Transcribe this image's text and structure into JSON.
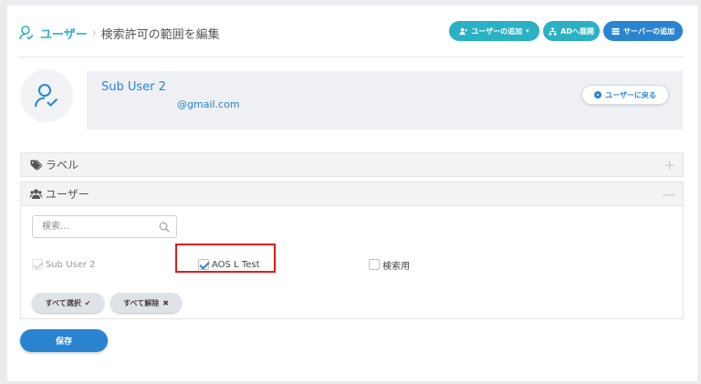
{
  "breadcrumb": {
    "root": "ユーザー",
    "separator": "›",
    "current": "検索許可の範囲を編集"
  },
  "header_buttons": {
    "add_user": "ユーザーの追加",
    "ad_deploy": "ADへ展開",
    "add_server": "サーバーの追加"
  },
  "profile": {
    "name": "Sub User 2",
    "email": "@gmail.com",
    "back_button": "ユーザーに戻る"
  },
  "sections": {
    "label": {
      "title": "ラベル",
      "toggle": "+"
    },
    "user": {
      "title": "ユーザー",
      "toggle": "—"
    }
  },
  "search": {
    "placeholder": "検索..."
  },
  "checkboxes": [
    {
      "label": "Sub User 2",
      "checked": true,
      "disabled": true
    },
    {
      "label": "AOS L Test",
      "checked": true,
      "disabled": false
    },
    {
      "label": "検索用",
      "checked": false,
      "disabled": false
    }
  ],
  "bulk": {
    "select_all": "すべて選択",
    "select_all_mark": "✔",
    "deselect_all": "すべて解除",
    "deselect_all_mark": "✖"
  },
  "save_label": "保存",
  "colors": {
    "teal": "#2bb1c4",
    "blue": "#2a84cf",
    "highlight": "#e11a1a"
  }
}
